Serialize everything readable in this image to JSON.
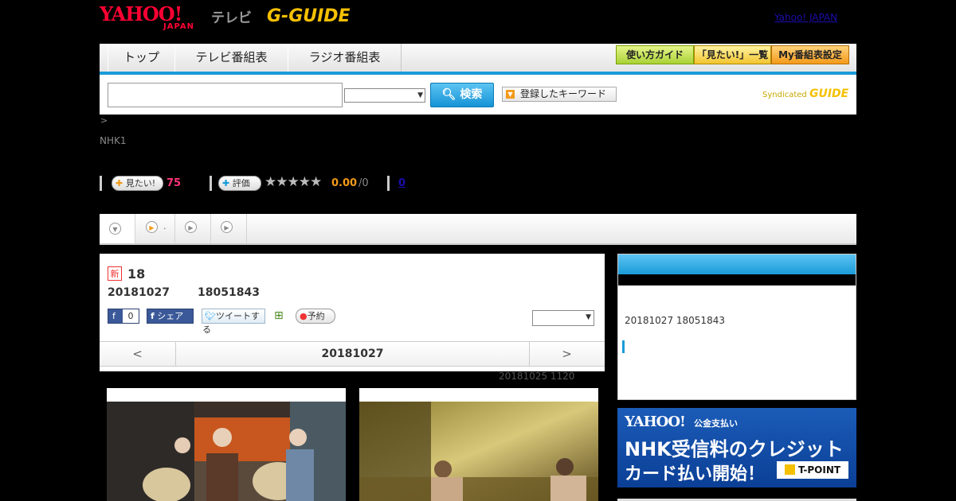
{
  "header": {
    "logo_yahoo": "YAHOO!",
    "logo_japan": "JAPAN",
    "logo_tv": "テレビ",
    "logo_gguide": "G-GUIDE",
    "yahoo_japan_link": "Yahoo! JAPAN"
  },
  "nav": {
    "tabs": [
      "トップ",
      "テレビ番組表",
      "ラジオ番組表"
    ],
    "guide_buttons": [
      "使い方ガイド",
      "「見たい!」一覧",
      "My番組表設定"
    ]
  },
  "search": {
    "button_label": "検索",
    "keyword_button": "登録したキーワード",
    "syndicated_label": "Syndicated",
    "syndicated_brand": "GUIDE"
  },
  "breadcrumb_arrow": ">",
  "channel": "NHK1",
  "stats": {
    "want_label": "見たい!",
    "want_count": "75",
    "rate_label": "評価",
    "stars": "★★★★★",
    "rating": "0.00",
    "rating_total": "/0",
    "review_count": "0"
  },
  "tabs_bar": {
    "tab2_label": "."
  },
  "program": {
    "new_badge": "新",
    "title": "18",
    "date": "20181027",
    "time": "18051843",
    "fb_count": "0",
    "share_label": "シェア",
    "tweet_label": "ツイートする",
    "reserve_label": "予約"
  },
  "date_nav": {
    "prev": "<",
    "current": "20181027",
    "next": ">"
  },
  "broadcast_note": "20181025  1120",
  "side": {
    "datetime": "20181027  18051843"
  },
  "ad": {
    "brand": "YAHOO!",
    "brand_sub": "公金支払い",
    "line1": "NHK受信料のクレジット",
    "line2": "カード払い開始！",
    "tpoint": "T-POINT"
  }
}
